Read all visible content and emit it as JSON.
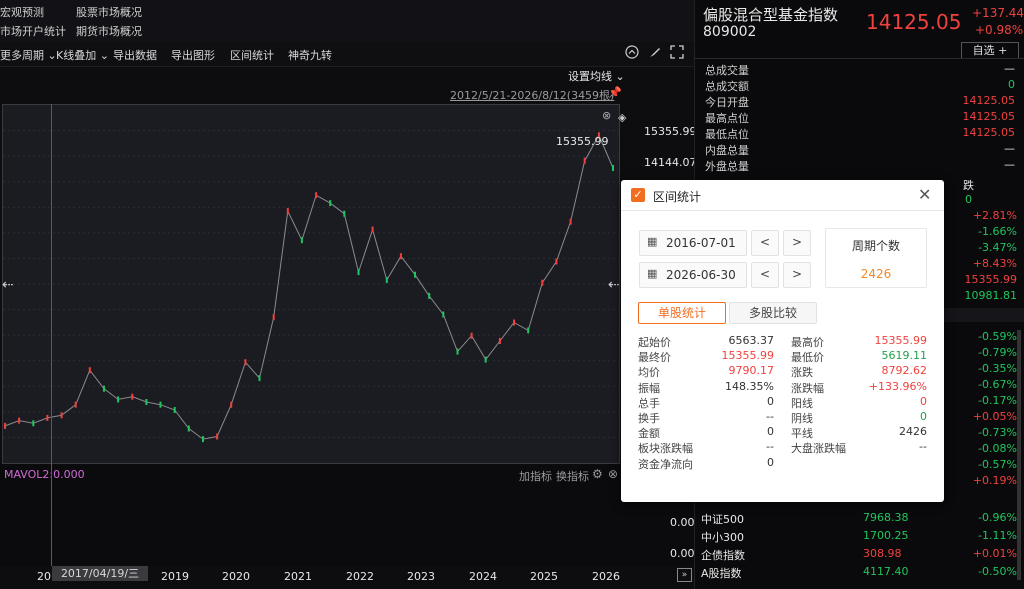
{
  "top_links": [
    "宏观预测",
    "股票市场概况",
    "市场开户统计",
    "期货市场概况"
  ],
  "toolbar": {
    "items": [
      "更多周期",
      "K线叠加",
      "导出数据",
      "导出图形",
      "区间统计",
      "神奇九转"
    ],
    "icons": [
      "circle-up-icon",
      "brush-icon",
      "expand-icon"
    ]
  },
  "chart": {
    "settings_label": "设置均线",
    "range_label": "2012/5/21-2026/8/12(3459根)",
    "high_marker": "15355.99",
    "price_ticks": [
      "15355.99",
      "14144.07"
    ],
    "vol_label": "MAVOL2:0.000",
    "vol_buttons": [
      "加指标",
      "换指标"
    ],
    "vol_ticks": [
      "0.00",
      "0.00"
    ],
    "date_tag": "2017/04/19/三",
    "x_ticks": [
      "20",
      "2019",
      "2020",
      "2021",
      "2022",
      "2023",
      "2024",
      "2025",
      "2026"
    ]
  },
  "chart_data": {
    "type": "line",
    "x": [
      "2012-05",
      "2013-01",
      "2013-06",
      "2014-01",
      "2014-06",
      "2015-01",
      "2015-05",
      "2015-09",
      "2016-01",
      "2016-07",
      "2017-01",
      "2017-06",
      "2018-01",
      "2018-06",
      "2018-10",
      "2019-01",
      "2019-06",
      "2020-01",
      "2020-03",
      "2020-07",
      "2021-01",
      "2021-03",
      "2021-06",
      "2021-09",
      "2021-12",
      "2022-04",
      "2022-07",
      "2022-10",
      "2023-01",
      "2023-04",
      "2023-08",
      "2023-10",
      "2024-02",
      "2024-05",
      "2024-09",
      "2024-10",
      "2025-01",
      "2025-04",
      "2025-08",
      "2025-10",
      "2026-01",
      "2026-04",
      "2026-06",
      "2026-08"
    ],
    "values": [
      4400,
      4600,
      4500,
      4700,
      4800,
      5200,
      6500,
      5800,
      5400,
      5500,
      5300,
      5200,
      5000,
      4300,
      3900,
      4000,
      5200,
      6800,
      6200,
      8500,
      12500,
      11400,
      13100,
      12800,
      12400,
      10200,
      11800,
      9900,
      10800,
      10100,
      9300,
      8600,
      7200,
      7800,
      6900,
      7600,
      8300,
      8000,
      9800,
      10600,
      12100,
      14400,
      15355.99,
      14125.05
    ],
    "xlabel": "",
    "ylabel": "",
    "ylim": [
      3000,
      16500
    ],
    "grid": true
  },
  "right_panel": {
    "fund_name": "偏股混合型基金指数",
    "fund_code": "809002",
    "price": "14125.05",
    "change": "+137.44",
    "change_pct": "+0.98%",
    "watch_button": "自选 +",
    "quote_rows": [
      {
        "label": "总成交量",
        "value": "—"
      },
      {
        "label": "总成交额",
        "value": "0"
      },
      {
        "label": "今日开盘",
        "value": "14125.05"
      },
      {
        "label": "最高点位",
        "value": "14125.05"
      },
      {
        "label": "最低点位",
        "value": "14125.05"
      },
      {
        "label": "内盘总量",
        "value": "—"
      },
      {
        "label": "外盘总量",
        "value": "—"
      }
    ],
    "partial_label": "跌",
    "partial_values": [
      "0",
      "+2.81%",
      "-1.66%",
      "-3.47%",
      "+8.43%",
      "15355.99",
      "10981.81"
    ],
    "index_pct": [
      "-0.59%",
      "-0.79%",
      "-0.35%",
      "-0.67%",
      "-0.17%",
      "+0.05%",
      "-0.73%",
      "-0.08%",
      "-0.57%",
      "+0.19%"
    ],
    "index_rows": [
      {
        "name": "中证500",
        "value": "7968.38",
        "pct": "-0.96%"
      },
      {
        "name": "中小300",
        "value": "1700.25",
        "pct": "-1.11%"
      },
      {
        "name": "企债指数",
        "value": "308.98",
        "pct": "+0.01%"
      },
      {
        "name": "A股指数",
        "value": "4117.40",
        "pct": "-0.50%"
      }
    ]
  },
  "dialog": {
    "title": "区间统计",
    "start_date": "2016-07-01",
    "end_date": "2026-06-30",
    "prev": "<",
    "next": ">",
    "period_label": "周期个数",
    "period_value": "2426",
    "tabs": [
      "单股统计",
      "多股比较"
    ],
    "left_stats": [
      {
        "label": "起始价",
        "value": "6563.37",
        "color": "#333333"
      },
      {
        "label": "最终价",
        "value": "15355.99",
        "color": "#f0413e"
      },
      {
        "label": "均价",
        "value": "9790.17",
        "color": "#f0413e"
      },
      {
        "label": "振幅",
        "value": "148.35%",
        "color": "#333333"
      },
      {
        "label": "总手",
        "value": "0",
        "color": "#333333"
      },
      {
        "label": "换手",
        "value": "--",
        "color": "#333333"
      },
      {
        "label": "金额",
        "value": "0",
        "color": "#333333"
      },
      {
        "label": "板块涨跌幅",
        "value": "--",
        "color": "#333333"
      },
      {
        "label": "资金净流向",
        "value": "0",
        "color": "#333333"
      }
    ],
    "right_stats": [
      {
        "label": "最高价",
        "value": "15355.99",
        "color": "#f0413e"
      },
      {
        "label": "最低价",
        "value": "5619.11",
        "color": "#21a04a"
      },
      {
        "label": "涨跌",
        "value": "8792.62",
        "color": "#f0413e"
      },
      {
        "label": "涨跌幅",
        "value": "+133.96%",
        "color": "#f0413e"
      },
      {
        "label": "阳线",
        "value": "0",
        "color": "#f0413e"
      },
      {
        "label": "阴线",
        "value": "0",
        "color": "#21a04a"
      },
      {
        "label": "平线",
        "value": "2426",
        "color": "#333333"
      },
      {
        "label": "大盘涨跌幅",
        "value": "--",
        "color": "#333333"
      }
    ]
  }
}
